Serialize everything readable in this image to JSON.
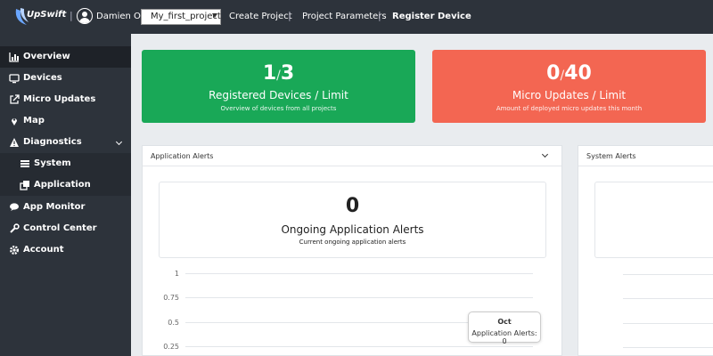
{
  "header": {
    "logo_text": "UpSwift",
    "user_name": "Damien Oh",
    "project_selected": "My_first_project",
    "separator": "|",
    "nav": [
      "Create Project",
      "Project Parameters",
      "Register Device"
    ]
  },
  "sidebar": {
    "items": [
      {
        "label": "Overview",
        "icon": "chart-icon",
        "active": true
      },
      {
        "label": "Devices",
        "icon": "monitor-icon"
      },
      {
        "label": "Micro Updates",
        "icon": "external-link-icon"
      },
      {
        "label": "Map",
        "icon": "map-pin-icon"
      },
      {
        "label": "Diagnostics",
        "icon": "warning-icon"
      },
      {
        "label": "System",
        "icon": "list-icon"
      },
      {
        "label": "Application",
        "icon": "windows-icon"
      },
      {
        "label": "App Monitor",
        "icon": "comment-icon"
      },
      {
        "label": "Control Center",
        "icon": "wrench-icon"
      },
      {
        "label": "Account",
        "icon": "gear-icon"
      }
    ]
  },
  "stats": {
    "devices": {
      "value": "1",
      "limit": "3",
      "title": "Registered Devices / Limit",
      "subtitle": "Overview of devices from all projects",
      "color": "#19a857"
    },
    "updates": {
      "value": "0",
      "limit": "40",
      "title": "Micro Updates / Limit",
      "subtitle": "Amount of deployed micro updates this month",
      "color": "#f36652"
    }
  },
  "app_alerts": {
    "title": "Application Alerts",
    "count": "0",
    "count_title": "Ongoing Application Alerts",
    "count_subtitle": "Current ongoing application alerts",
    "tooltip_month": "Oct",
    "tooltip_text": "Application Alerts: 0"
  },
  "system_alerts": {
    "title": "System Alerts"
  },
  "chart_data": {
    "type": "line",
    "y_ticks": [
      "1",
      "0.75",
      "0.5",
      "0.25"
    ]
  }
}
